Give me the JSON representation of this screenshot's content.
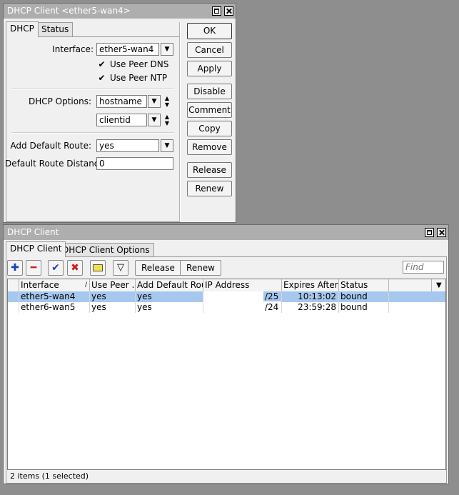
{
  "dhcp_window": {
    "title": "DHCP Client <ether5-wan4>",
    "tabs": [
      "DHCP",
      "Status"
    ],
    "interface_label": "Interface:",
    "interface_value": "ether5-wan4",
    "use_peer_dns_label": "Use Peer DNS",
    "use_peer_ntp_label": "Use Peer NTP",
    "check_mark": "✔",
    "dhcp_options_label": "DHCP Options:",
    "dhcp_option_1": "hostname",
    "dhcp_option_2": "clientid",
    "add_default_route_label": "Add Default Route:",
    "add_default_route_value": "yes",
    "default_route_distance_label": "Default Route Distance:",
    "default_route_distance_value": "0",
    "buttons": {
      "ok": "OK",
      "cancel": "Cancel",
      "apply": "Apply",
      "disable": "Disable",
      "comment": "Comment",
      "copy": "Copy",
      "remove": "Remove",
      "release": "Release",
      "renew": "Renew"
    }
  },
  "list_window": {
    "title": "DHCP Client",
    "tabs": [
      "DHCP Client",
      "DHCP Client Options"
    ],
    "toolbar": {
      "release": "Release",
      "renew": "Renew",
      "find_placeholder": "Find"
    },
    "columns": [
      "Interface",
      "Use Peer ...",
      "Add Default Route",
      "IP Address",
      "Expires After",
      "Status"
    ],
    "rows": [
      {
        "interface": "ether5-wan4",
        "use_peer": "yes",
        "add_default_route": "yes",
        "ip": "/25",
        "expires": "10:13:02",
        "status": "bound"
      },
      {
        "interface": "ether6-wan5",
        "use_peer": "yes",
        "add_default_route": "yes",
        "ip": "/24",
        "expires": "23:59:28",
        "status": "bound"
      }
    ],
    "status_text": "2 items (1 selected)"
  }
}
